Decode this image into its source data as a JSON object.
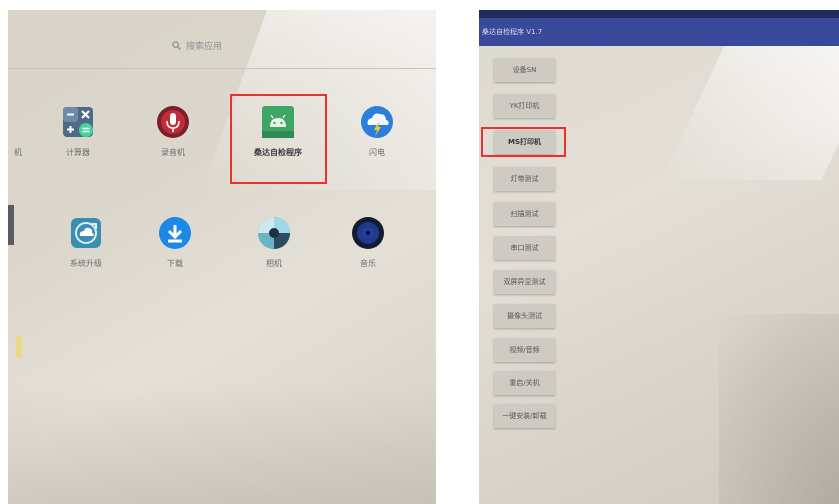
{
  "launcher": {
    "search": {
      "placeholder": "搜索应用",
      "icon": "search-icon"
    },
    "partial_label": "机",
    "apps_row1": [
      {
        "label": "计算器",
        "icon": "calculator-icon"
      },
      {
        "label": "录音机",
        "icon": "microphone-icon"
      },
      {
        "label": "桑达自检程序",
        "icon": "android-icon",
        "highlighted": true
      },
      {
        "label": "闪电",
        "icon": "cloud-lightning-icon"
      }
    ],
    "apps_row2": [
      {
        "label": "系统升级",
        "icon": "cloud-update-icon"
      },
      {
        "label": "下载",
        "icon": "download-icon"
      },
      {
        "label": "相机",
        "icon": "camera-aperture-icon"
      },
      {
        "label": "音乐",
        "icon": "music-icon"
      }
    ]
  },
  "test_app": {
    "title": "桑达自检程序 V1.7",
    "accent_color": "#3a4a9a",
    "buttons": [
      {
        "label": "设备SN"
      },
      {
        "label": "YK打印机"
      },
      {
        "label": "MS打印机",
        "highlighted": true
      },
      {
        "label": "灯带测试"
      },
      {
        "label": "扫描测试"
      },
      {
        "label": "串口测试"
      },
      {
        "label": "双屏异显测试"
      },
      {
        "label": "摄像头测试"
      },
      {
        "label": "视频/音频"
      },
      {
        "label": "重启/关机"
      },
      {
        "label": "一键安装/卸载"
      }
    ]
  },
  "highlight_color": "#e8322e"
}
